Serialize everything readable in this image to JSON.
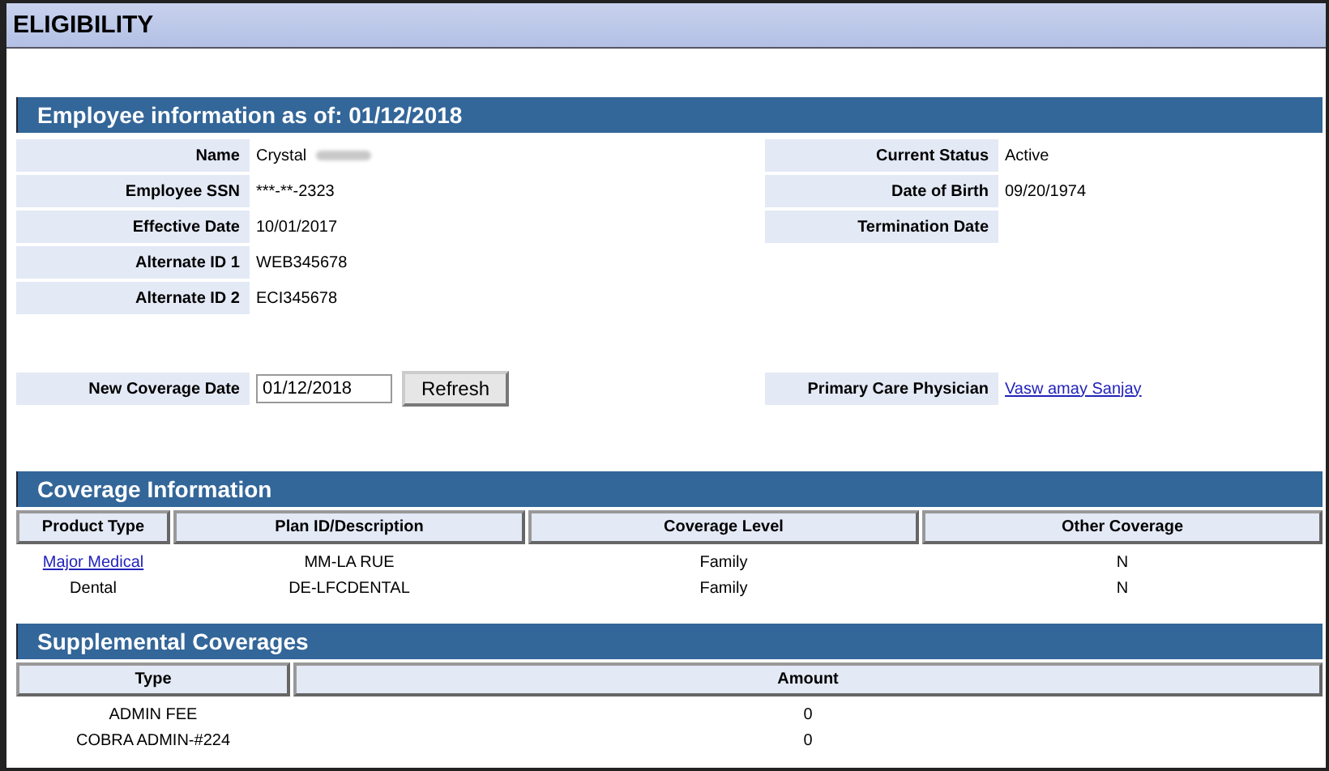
{
  "title": "ELIGIBILITY",
  "employee": {
    "title": "Employee information as of:  01/12/2018",
    "left_fields": [
      {
        "label": "Name",
        "value": "Crystal",
        "redacted": true
      },
      {
        "label": "Employee SSN",
        "value": "***-**-2323",
        "redacted": false
      },
      {
        "label": "Effective Date",
        "value": "10/01/2017",
        "redacted": false
      },
      {
        "label": "Alternate ID 1",
        "value": "WEB345678",
        "redacted": false
      },
      {
        "label": "Alternate ID 2",
        "value": "ECI345678",
        "redacted": false
      }
    ],
    "right_fields": [
      {
        "label": "Current Status",
        "value": "Active"
      },
      {
        "label": "Date of Birth",
        "value": "09/20/1974"
      },
      {
        "label": "Termination Date"
      }
    ],
    "new_coverage": {
      "label": "New Coverage Date",
      "value": "01/12/2018"
    },
    "refresh_button": "Refresh",
    "pcp": {
      "label": "Primary Care Physician",
      "value": "Vasw amay Sanjay"
    }
  },
  "coverage": {
    "title": "Coverage Information",
    "columns": [
      "Product Type",
      "Plan ID/Description",
      "Coverage Level",
      "Other Coverage"
    ],
    "rows": [
      {
        "product": "Major Medical",
        "link": true,
        "plan": "MM-LA RUE",
        "level": "Family",
        "other": "N"
      },
      {
        "product": "Dental",
        "link": false,
        "plan": "DE-LFCDENTAL",
        "level": "Family",
        "other": "N"
      }
    ]
  },
  "supplemental": {
    "title": "Supplemental Coverages",
    "columns": [
      "Type",
      "Amount"
    ],
    "rows": [
      {
        "type": "ADMIN FEE",
        "amount": "0"
      },
      {
        "type": "COBRA ADMIN-#224",
        "amount": "0"
      }
    ]
  }
}
